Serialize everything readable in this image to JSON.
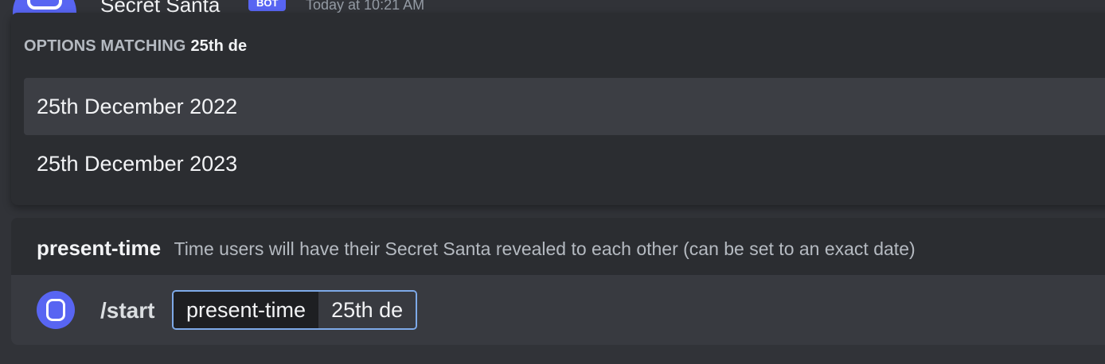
{
  "message": {
    "author": "Secret Santa",
    "badge": "BOT",
    "timestamp": "Today at 10:21 AM"
  },
  "autocomplete": {
    "header_prefix": "OPTIONS MATCHING",
    "query": "25th de",
    "options": [
      {
        "label": "25th December 2022",
        "selected": true
      },
      {
        "label": "25th December 2023",
        "selected": false
      }
    ]
  },
  "parameter": {
    "name": "present-time",
    "description": "Time users will have their Secret Santa revealed to each other (can be set to an exact date)"
  },
  "command_input": {
    "command": "/start",
    "option_name": "present-time",
    "option_value": "25th de"
  },
  "colors": {
    "background": "#313338",
    "panel": "#2b2d31",
    "selected_option": "#3c3e44",
    "accent": "#5865f2",
    "focus_border": "#7eaae9"
  }
}
